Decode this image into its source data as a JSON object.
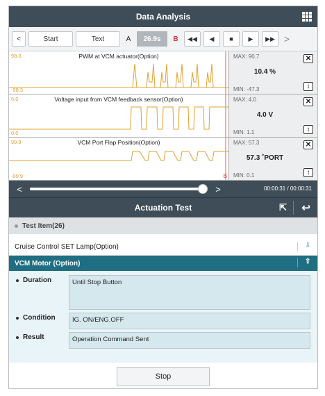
{
  "header": {
    "title": "Data Analysis",
    "menu_icon": "grid-icon"
  },
  "toolbar": {
    "start_label": "Start",
    "text_label": "Text",
    "a_label": "A",
    "time_value": "26.9s",
    "b_label": "B",
    "prev_icon": "chevron-left-icon",
    "next_icon": "chevron-right-icon",
    "rewind_icon": "rewind-icon",
    "back_icon": "step-back-icon",
    "stop_icon": "stop-icon",
    "play_icon": "play-icon",
    "ff_icon": "fast-forward-icon"
  },
  "graphs": [
    {
      "title": "PWM at VCM actuator(Option)",
      "ymax": "98.3",
      "ymin": "-98.3",
      "max": "MAX: 90.7",
      "current": "10.4 %",
      "min": "MIN: -47.3"
    },
    {
      "title": "Voltage input from VCM feedback sensor(Option)",
      "ymax": "5.0",
      "ymin": "0.0",
      "max": "MAX: 4.0",
      "current": "4.0 V",
      "min": "MIN: 1.1"
    },
    {
      "title": "VCM Port Flap Position(Option)",
      "ymax": "99.9",
      "ymin": "-99.9",
      "max": "MAX: 57.3",
      "current": "57.3 ˚PORT",
      "min": "MIN: 0.1",
      "b_marker": "B"
    }
  ],
  "scrubber": {
    "time": "00:00:31 / 00:00:31",
    "position": 1.0
  },
  "actuation": {
    "title": "Actuation Test",
    "test_items_label": "Test Item(26)",
    "items": [
      {
        "label": "Cruise Control SET Lamp(Option)"
      }
    ],
    "selected": {
      "label": "VCM Motor (Option)"
    },
    "details": {
      "duration_label": "Duration",
      "duration_value": "Until Stop Button",
      "condition_label": "Condition",
      "condition_value": "IG. ON/ENG.OFF",
      "result_label": "Result",
      "result_value": "Operation Command Sent"
    },
    "stop_label": "Stop"
  },
  "colors": {
    "header_bg": "#3f4d58",
    "selected_bg": "#1f6e82",
    "signal": "#e0a030",
    "marker_b": "#dd3333"
  }
}
